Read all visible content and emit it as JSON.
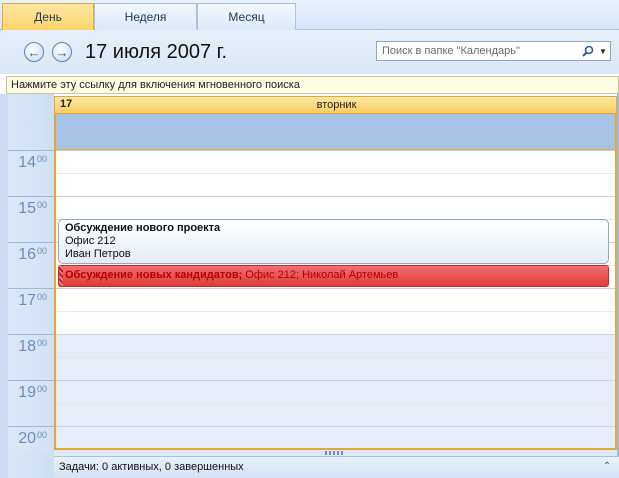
{
  "tabs": [
    {
      "label": "День",
      "active": true
    },
    {
      "label": "Неделя",
      "active": false
    },
    {
      "label": "Месяц",
      "active": false
    }
  ],
  "header": {
    "date_title": "17 июля 2007 г.",
    "prev_icon": "arrow-left-icon",
    "next_icon": "arrow-right-icon"
  },
  "search": {
    "placeholder": "Поиск в папке \"Календарь\"",
    "value": "",
    "icon": "search-icon"
  },
  "infobar": {
    "text": "Нажмите эту ссылку для включения мгновенного поиска"
  },
  "day": {
    "number": "17",
    "name": "вторник"
  },
  "hours": [
    {
      "hour": "14",
      "min": "00"
    },
    {
      "hour": "15",
      "min": "00"
    },
    {
      "hour": "16",
      "min": "00"
    },
    {
      "hour": "17",
      "min": "00"
    },
    {
      "hour": "18",
      "min": "00"
    },
    {
      "hour": "19",
      "min": "00"
    },
    {
      "hour": "20",
      "min": "00"
    }
  ],
  "appointments": [
    {
      "subject": "Обсуждение нового проекта",
      "location": "Офис 212",
      "organizer": "Иван Петров"
    },
    {
      "subject": "Обсуждение новых кандидатов;",
      "details": " Офис 212; Николай Артемьев"
    }
  ],
  "tasks": {
    "text": "Задачи: 0 активных, 0 завершенных"
  },
  "colors": {
    "accent": "#ffd46b",
    "frame": "#e3a833",
    "appt_red": "#e03b3b",
    "offhours": "#e6edf8"
  }
}
